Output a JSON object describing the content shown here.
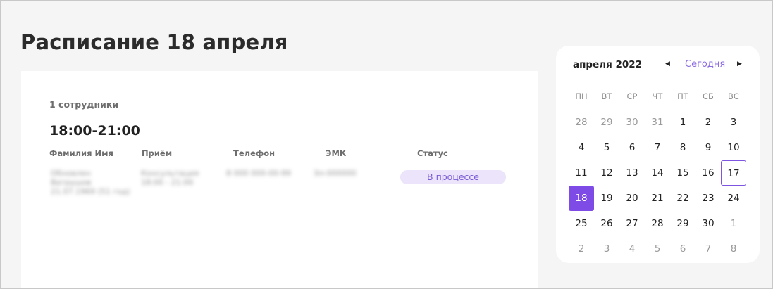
{
  "page": {
    "title": "Расписание 18 апреля"
  },
  "schedule": {
    "employee_count": "1 сотрудники",
    "time_slot": "18:00-21:00",
    "columns": [
      "Фамилия Имя",
      "Приём",
      "Телефон",
      "ЭМК",
      "Статус"
    ],
    "rows": [
      {
        "name_line1": "Обновлен",
        "name_line2": "Ватрушов",
        "name_line3": "21.07.1969 (51 год)",
        "reception_line1": "Консультация",
        "reception_line2": "18:00 - 21:00",
        "phone": "8 000 000-00-99",
        "emk": "Эл-000000",
        "status": "В процессе"
      }
    ]
  },
  "calendar": {
    "month_label": "апреля 2022",
    "today_label": "Сегодня",
    "prev_icon": "◀",
    "next_icon": "▶",
    "weekdays": [
      "ПН",
      "ВТ",
      "СР",
      "ЧТ",
      "ПТ",
      "СБ",
      "ВС"
    ],
    "weeks": [
      [
        "28",
        "29",
        "30",
        "31",
        "1",
        "2",
        "3"
      ],
      [
        "4",
        "5",
        "6",
        "7",
        "8",
        "9",
        "10"
      ],
      [
        "11",
        "12",
        "13",
        "14",
        "15",
        "16",
        "17"
      ],
      [
        "18",
        "19",
        "20",
        "21",
        "22",
        "23",
        "24"
      ],
      [
        "25",
        "26",
        "27",
        "28",
        "29",
        "30",
        "1"
      ],
      [
        "2",
        "3",
        "4",
        "5",
        "6",
        "7",
        "8"
      ]
    ],
    "selected_day": "18",
    "today_day": "17",
    "accent_color": "#7e4be6"
  }
}
